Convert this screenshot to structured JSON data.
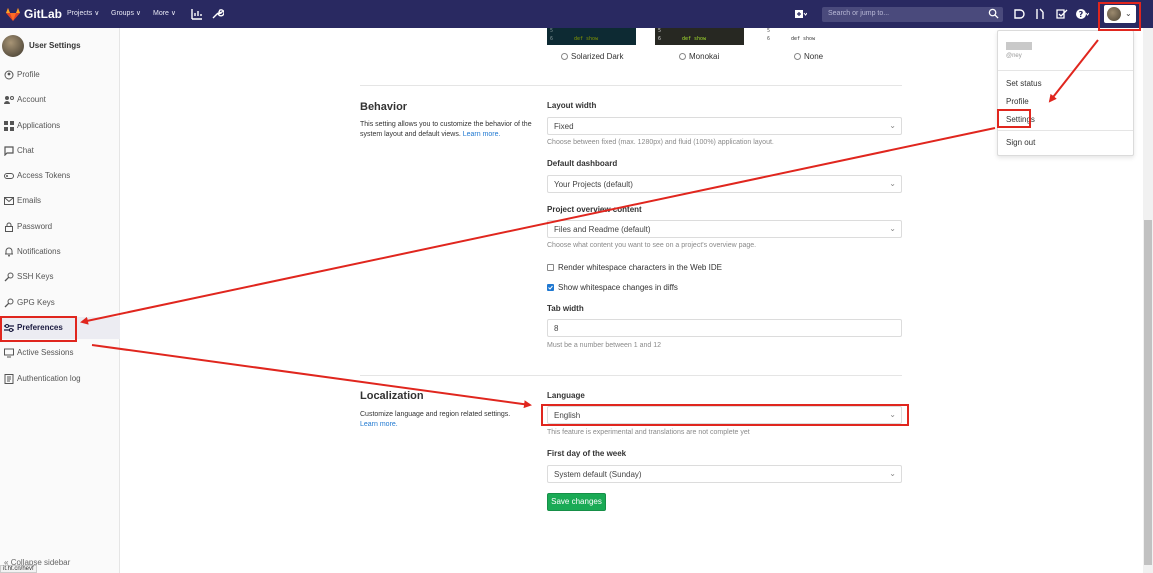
{
  "navbar": {
    "brand": "GitLab",
    "links": [
      "Projects ∨",
      "Groups ∨",
      "More ∨"
    ],
    "search_placeholder": "Search or jump to...",
    "brand_color": "#292961"
  },
  "sidebar": {
    "title": "User Settings",
    "items": [
      {
        "label": "Profile",
        "icon": "profile-icon"
      },
      {
        "label": "Account",
        "icon": "account-icon"
      },
      {
        "label": "Applications",
        "icon": "applications-icon"
      },
      {
        "label": "Chat",
        "icon": "chat-icon"
      },
      {
        "label": "Access Tokens",
        "icon": "token-icon"
      },
      {
        "label": "Emails",
        "icon": "email-icon"
      },
      {
        "label": "Password",
        "icon": "lock-icon"
      },
      {
        "label": "Notifications",
        "icon": "bell-icon"
      },
      {
        "label": "SSH Keys",
        "icon": "key-icon"
      },
      {
        "label": "GPG Keys",
        "icon": "key-icon"
      },
      {
        "label": "Preferences",
        "icon": "preferences-icon"
      },
      {
        "label": "Active Sessions",
        "icon": "monitor-icon"
      },
      {
        "label": "Authentication log",
        "icon": "log-icon"
      }
    ],
    "collapse_label": "Collapse sidebar",
    "status_url": "it.ht.cn/hevf"
  },
  "syntax_themes": {
    "code_lines": [
      "5",
      "6",
      "def show"
    ],
    "options": [
      "Solarized Dark",
      "Monokai",
      "None"
    ]
  },
  "behavior": {
    "title": "Behavior",
    "description": "This setting allows you to customize the behavior of the system layout and default views.",
    "learn_more": "Learn more.",
    "layout_width_label": "Layout width",
    "layout_width_value": "Fixed",
    "layout_width_help": "Choose between fixed (max. 1280px) and fluid (100%) application layout.",
    "default_dashboard_label": "Default dashboard",
    "default_dashboard_value": "Your Projects (default)",
    "project_overview_label": "Project overview content",
    "project_overview_value": "Files and Readme (default)",
    "project_overview_help": "Choose what content you want to see on a project's overview page.",
    "render_whitespace_label": "Render whitespace characters in the Web IDE",
    "render_whitespace_checked": false,
    "show_whitespace_label": "Show whitespace changes in diffs",
    "show_whitespace_checked": true,
    "tab_width_label": "Tab width",
    "tab_width_value": "8",
    "tab_width_help": "Must be a number between 1 and 12"
  },
  "localization": {
    "title": "Localization",
    "description": "Customize language and region related settings.",
    "learn_more": "Learn more.",
    "language_label": "Language",
    "language_value": "English",
    "language_help": "This feature is experimental and translations are not complete yet",
    "first_day_label": "First day of the week",
    "first_day_value": "System default (Sunday)"
  },
  "save_button": "Save changes",
  "user_menu": {
    "handle": "@ney",
    "items": [
      "Set status",
      "Profile",
      "Settings",
      "Sign out"
    ]
  },
  "annotation_color": "#e0261e"
}
